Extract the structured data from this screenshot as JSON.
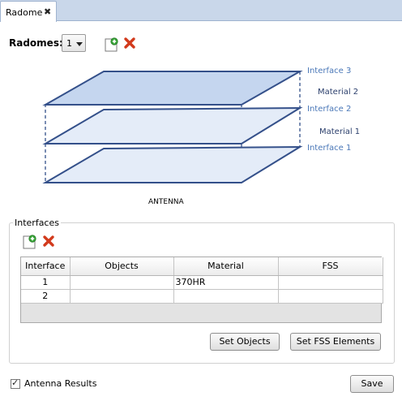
{
  "tab": {
    "label": "Radome",
    "close_symbol": "✖"
  },
  "radomes": {
    "label": "Radomes:",
    "selected": "1"
  },
  "diagram": {
    "interfaces": [
      "Interface 3",
      "Interface 2",
      "Interface 1"
    ],
    "materials": [
      "Material 2",
      "Material 1"
    ],
    "bottom_label": "ANTENNA",
    "colors": {
      "layer_top": "#c5d6ef",
      "layer": "#e4ecf8",
      "edge": "#34508a",
      "label": "#4b78b8"
    }
  },
  "interfaces_group": {
    "title": "Interfaces",
    "columns": [
      "Interface",
      "Objects",
      "Material",
      "FSS"
    ],
    "rows": [
      {
        "interface": "1",
        "objects": "",
        "material": "370HR",
        "fss": ""
      },
      {
        "interface": "2",
        "objects": "",
        "material": "",
        "fss": ""
      }
    ],
    "set_objects_label": "Set Objects",
    "set_fss_label": "Set FSS Elements"
  },
  "antenna_results": {
    "label": "Antenna Results",
    "checked": true
  },
  "save_label": "Save",
  "icons": {
    "add": "add-document-icon",
    "delete": "delete-x-icon"
  }
}
